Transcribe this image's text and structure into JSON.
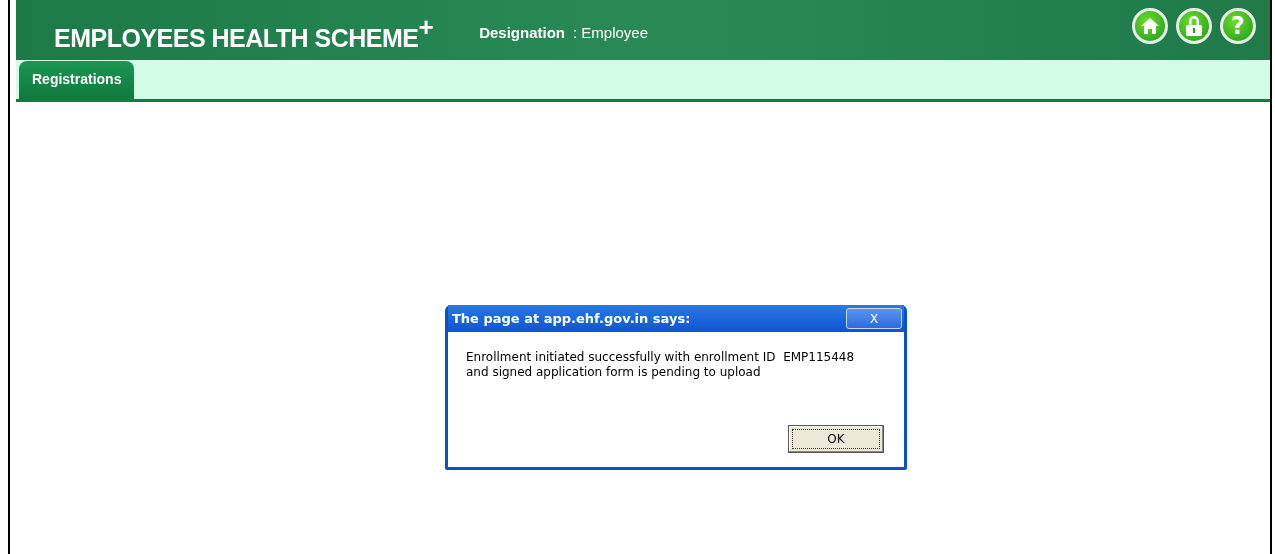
{
  "header": {
    "title": "EMPLOYEES HEALTH SCHEME$^{+}$",
    "designation_label": "Designation",
    "designation_value": ": Employee",
    "icons": [
      {
        "kind": "home"
      },
      {
        "kind": "lock"
      },
      {
        "kind": "help",
        "symbol": "?"
      }
    ]
  },
  "tabs": [
    {
      "label": "Registrations",
      "selected": true
    }
  ],
  "dialog": {
    "title": "The page at app.ehf.gov.in says:",
    "close": "X",
    "message_lines": [
      "Enrollment initiated successfully with enrollment ID  EMP115448",
      "and signed application form is pending to upload"
    ],
    "button": "OK"
  }
}
